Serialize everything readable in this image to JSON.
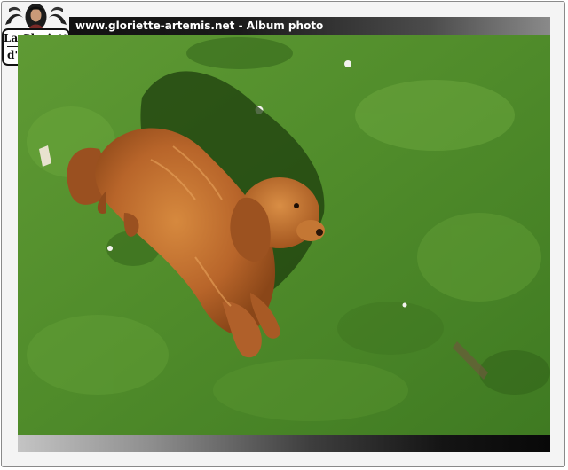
{
  "header": {
    "title": "www.gloriette-artemis.net - Album photo"
  },
  "logo": {
    "line1": "La Gloriette",
    "line2": "d'Artémis"
  },
  "photo": {
    "subject": "dog-on-grass"
  },
  "colors": {
    "title_bar": "#121212",
    "title_text": "#ffffff",
    "grass": "#4f8a2c",
    "dog": "#b5652a",
    "page_background": "#f4f4f4"
  }
}
